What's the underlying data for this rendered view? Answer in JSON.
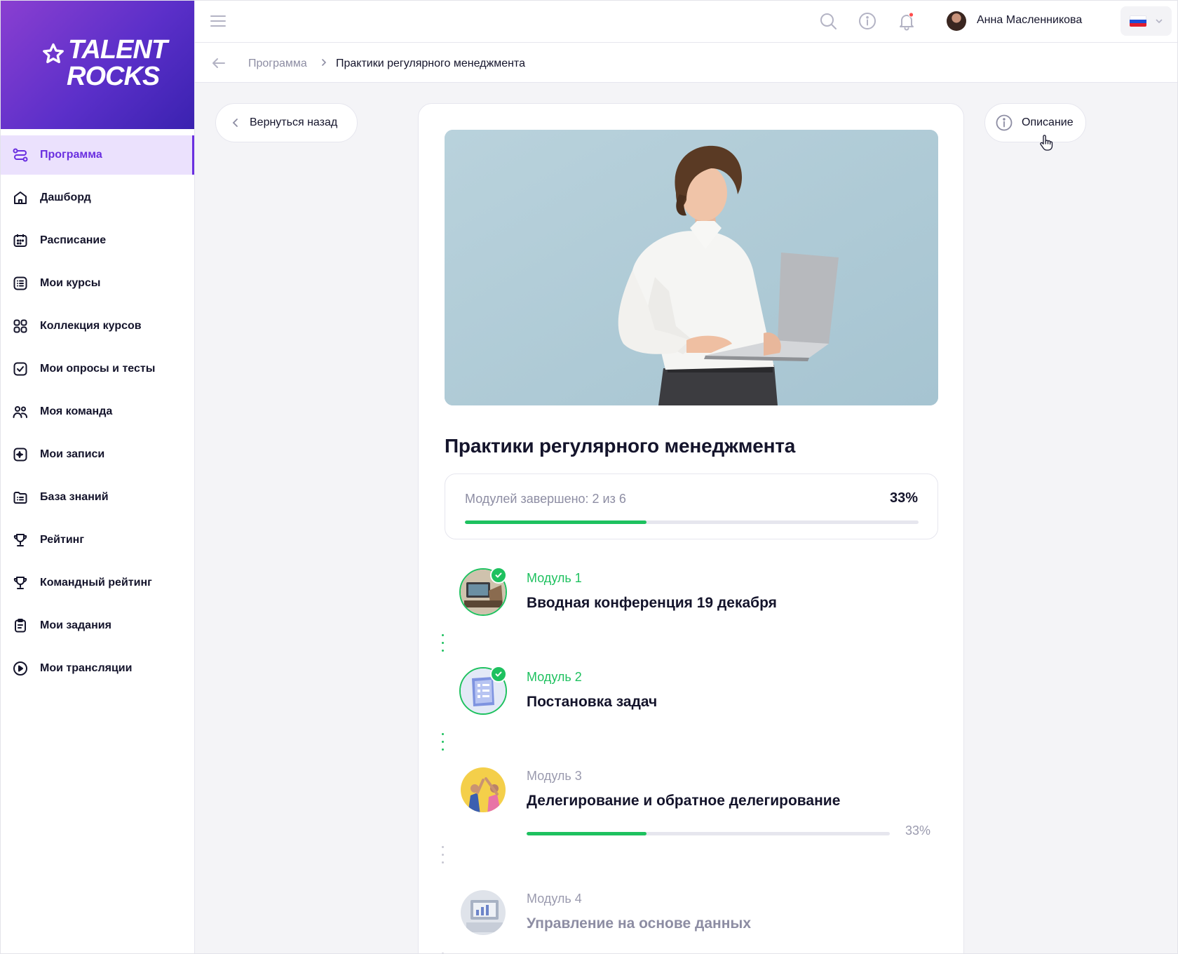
{
  "brand": {
    "line1": "TALENT",
    "line2": "ROCKS"
  },
  "sidebar": {
    "items": [
      {
        "label": "Программа",
        "icon": "route-icon",
        "active": true
      },
      {
        "label": "Дашборд",
        "icon": "home-icon"
      },
      {
        "label": "Расписание",
        "icon": "calendar-icon"
      },
      {
        "label": "Мои курсы",
        "icon": "list-icon"
      },
      {
        "label": "Коллекция курсов",
        "icon": "grid-icon"
      },
      {
        "label": "Мои опросы и тесты",
        "icon": "checkbox-icon"
      },
      {
        "label": "Моя команда",
        "icon": "team-icon"
      },
      {
        "label": "Мои записи",
        "icon": "note-icon"
      },
      {
        "label": "База знаний",
        "icon": "folder-icon"
      },
      {
        "label": "Рейтинг",
        "icon": "trophy-icon"
      },
      {
        "label": "Командный рейтинг",
        "icon": "trophy-icon"
      },
      {
        "label": "Мои задания",
        "icon": "clipboard-icon"
      },
      {
        "label": "Мои трансляции",
        "icon": "play-icon"
      }
    ]
  },
  "header": {
    "user_name": "Анна Масленникова",
    "language": "ru",
    "icons": [
      "menu-icon",
      "search-icon",
      "info-icon",
      "bell-icon",
      "chevron-down-icon"
    ]
  },
  "breadcrumb": {
    "parent": "Программа",
    "current": "Практики регулярного менеджмента"
  },
  "buttons": {
    "back": "Вернуться назад",
    "description": "Описание"
  },
  "program": {
    "title": "Практики регулярного менеджмента",
    "progress_label": "Модулей завершено: 2 из 6",
    "progress_pct_text": "33%",
    "progress_fraction": 0.4
  },
  "modules": [
    {
      "num": "Модуль 1",
      "name": "Вводная конференция 19 декабря",
      "done": true
    },
    {
      "num": "Модуль 2",
      "name": "Постановка задач",
      "done": true
    },
    {
      "num": "Модуль 3",
      "name": "Делегирование и обратное делегирование",
      "done": false,
      "progress_text": "33%",
      "progress_fraction": 0.33
    },
    {
      "num": "Модуль 4",
      "name": "Управление на основе данных",
      "done": false,
      "locked": true
    }
  ],
  "colors": {
    "accent": "#6a2fe0",
    "success": "#1ec15f",
    "muted": "#8d8da3"
  }
}
